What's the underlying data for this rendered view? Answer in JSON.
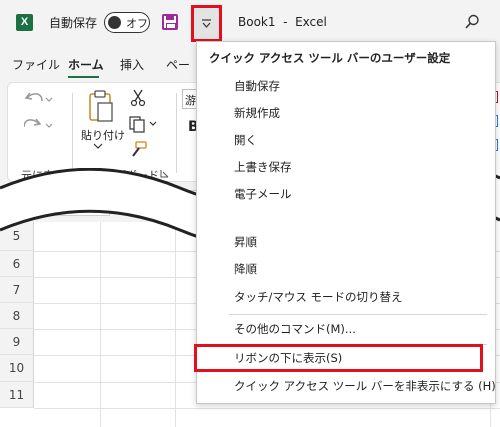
{
  "titlebar": {
    "autosave_label": "自動保存",
    "toggle_state": "オフ",
    "doc_title": "Book1  -  Excel"
  },
  "tabs": [
    "ファイル",
    "ホーム",
    "挿入",
    "ペー"
  ],
  "active_tab": "ホーム",
  "ribbon": {
    "paste_label": "貼り付け",
    "undo_group_label": "元に戻す",
    "clipboard_group_label": "クリップボード",
    "font_fragment": "游"
  },
  "grid": {
    "rows": [
      "5",
      "6",
      "7",
      "8",
      "9",
      "10",
      "11"
    ]
  },
  "menu": {
    "header": "クイック アクセス ツール バーのユーザー設定",
    "items": [
      "自動保存",
      "新規作成",
      "開く",
      "上書き保存",
      "電子メール",
      "昇順",
      "降順",
      "タッチ/マウス モードの切り替え",
      "その他のコマンド(M)...",
      "リボンの下に表示(S)",
      "クイック アクセス ツール バーを非表示にする (H)"
    ]
  },
  "colors": {
    "accent": "#1d7044",
    "highlight_border": "#e0101c",
    "save_icon": "#9e2b9a"
  }
}
